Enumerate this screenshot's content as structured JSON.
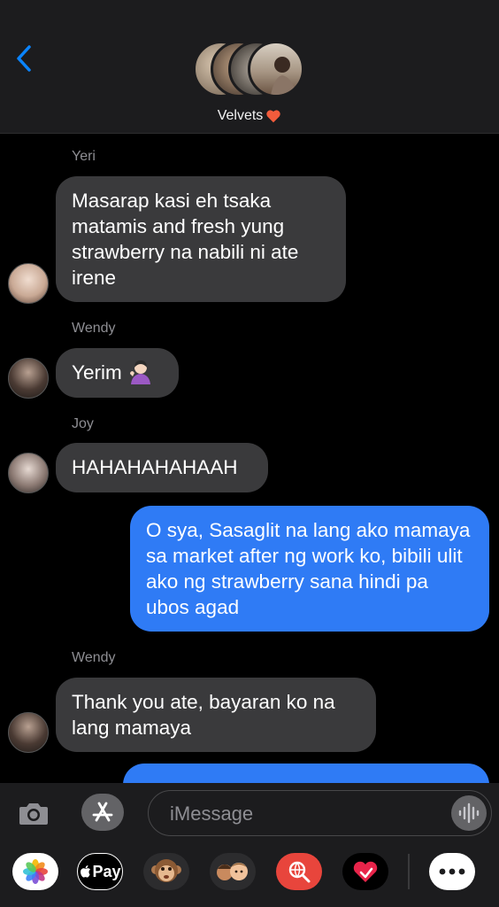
{
  "header": {
    "back_icon": "chevron-left-icon",
    "group_name": "Velvets",
    "heart_emoji": "heart-icon"
  },
  "messages": [
    {
      "sender": "Yeri",
      "text": "Masarap kasi eh tsaka matamis and fresh yung strawberry na nabili ni ate irene",
      "direction": "in"
    },
    {
      "sender": "Wendy",
      "text": "Yerim",
      "direction": "in",
      "emoji": "woman-tipping-hand-emoji"
    },
    {
      "sender": "Joy",
      "text": "HAHAHAHAHAAH",
      "direction": "in"
    },
    {
      "text": "O sya, Sasaglit na lang ako mamaya sa market after ng work ko, bibili ulit ako ng strawberry sana hindi pa ubos agad",
      "direction": "out"
    },
    {
      "sender": "Wendy",
      "text": "Thank you ate, bayaran ko na lang mamaya",
      "direction": "in"
    }
  ],
  "composer": {
    "placeholder": "iMessage"
  },
  "tray": {
    "apple_pay_label": "Pay"
  },
  "colors": {
    "outgoing_bubble": "#2f7bf5",
    "incoming_bubble": "#3a3a3c",
    "accent": "#0a84ff"
  }
}
